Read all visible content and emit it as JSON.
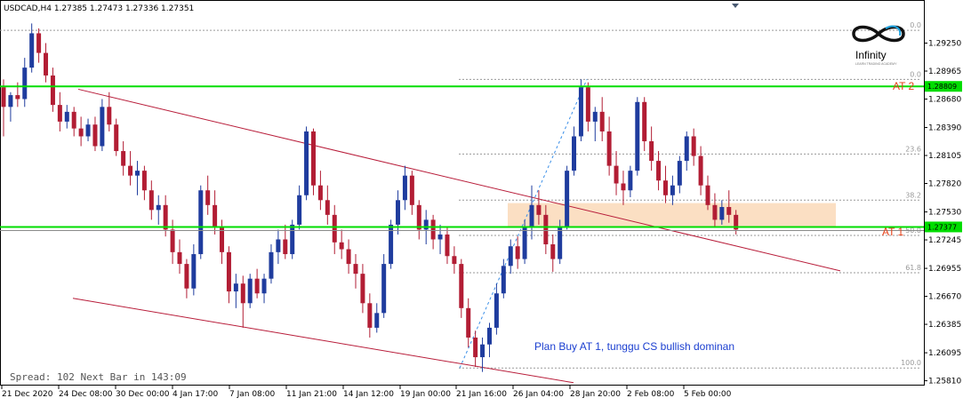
{
  "header": {
    "text": "USDCAD,H4  1.27385 1.27473 1.27336 1.27351"
  },
  "logo": {
    "name": "Infinity",
    "tagline": "LEARN TRADING ACADEMY"
  },
  "status": {
    "spread": "Spread: 102 Next Bar in 143:09"
  },
  "note": {
    "text": "Plan Buy AT 1, tunggu CS bullish dominan"
  },
  "levels": {
    "at2": {
      "label": "AT 2",
      "price": 1.28809,
      "badge": "1.28809"
    },
    "at1": {
      "label": "AT 1",
      "price": 1.27377,
      "badge": "1.27377"
    }
  },
  "colors": {
    "bull": "#1f3c9e",
    "bear": "#b21d34",
    "level": "#00dd00",
    "channel": "#b81d3a",
    "zone": "#fbdfc3",
    "fib": "#9a9a9a",
    "fib_trend": "#3b8fe8"
  },
  "chart_data": {
    "type": "candlestick",
    "symbol": "USDCAD",
    "timeframe": "H4",
    "ohlc_current": {
      "open": 1.27385,
      "high": 1.27473,
      "low": 1.27336,
      "close": 1.27351
    },
    "ylim": [
      1.2577,
      1.2968
    ],
    "y_ticks": [
      "1.29250",
      "1.28965",
      "1.28680",
      "1.28390",
      "1.28105",
      "1.27820",
      "1.27530",
      "1.27245",
      "1.26955",
      "1.26670",
      "1.26385",
      "1.26095",
      "1.25810"
    ],
    "x_ticks": [
      "21 Dec 2020",
      "24 Dec 08:00",
      "30 Dec 00:00",
      "4 Jan 17:00",
      "7 Jan 08:00",
      "11 Jan 21:00",
      "14 Jan 12:00",
      "19 Jan 00:00",
      "21 Jan 16:00",
      "26 Jan 04:00",
      "28 Jan 20:00",
      "2 Feb 08:00",
      "5 Feb 00:00"
    ],
    "fibonacci": {
      "levels": [
        {
          "label": "0.0",
          "price": 1.2938
        },
        {
          "label": "0.0",
          "price": 1.2888
        },
        {
          "label": "23.6",
          "price": 1.2812
        },
        {
          "label": "38.2",
          "price": 1.2765
        },
        {
          "label": "50.0",
          "price": 1.2729
        },
        {
          "label": "61.8",
          "price": 1.2691
        },
        {
          "label": "100.0",
          "price": 1.2594
        }
      ]
    },
    "channel_upper": [
      {
        "x": "24 Dec 08:00",
        "y": 1.2878
      },
      {
        "x": "26 Jan 04:00",
        "y": 1.2766
      },
      {
        "x": "8 Feb",
        "y": 1.2693
      }
    ],
    "channel_lower": [
      {
        "x": "23 Dec",
        "y": 1.2665
      },
      {
        "x": "21 Jan 16:00",
        "y": 1.259
      },
      {
        "x": "28 Jan 20:00",
        "y": 1.2579
      }
    ],
    "zone": {
      "price_high": 1.2762,
      "price_low": 1.2738,
      "from": "21 Jan 16:00",
      "to": "8 Feb"
    },
    "candles": [
      {
        "o": 1.288,
        "h": 1.2888,
        "l": 1.283,
        "c": 1.286
      },
      {
        "o": 1.286,
        "h": 1.2875,
        "l": 1.2845,
        "c": 1.2872
      },
      {
        "o": 1.2872,
        "h": 1.2885,
        "l": 1.286,
        "c": 1.2868
      },
      {
        "o": 1.2868,
        "h": 1.291,
        "l": 1.286,
        "c": 1.29
      },
      {
        "o": 1.29,
        "h": 1.2945,
        "l": 1.2895,
        "c": 1.2935
      },
      {
        "o": 1.2935,
        "h": 1.294,
        "l": 1.2905,
        "c": 1.2915
      },
      {
        "o": 1.2915,
        "h": 1.2925,
        "l": 1.2885,
        "c": 1.2892
      },
      {
        "o": 1.2892,
        "h": 1.29,
        "l": 1.2855,
        "c": 1.2862
      },
      {
        "o": 1.2862,
        "h": 1.2875,
        "l": 1.2835,
        "c": 1.2845
      },
      {
        "o": 1.2845,
        "h": 1.2862,
        "l": 1.2838,
        "c": 1.2855
      },
      {
        "o": 1.2855,
        "h": 1.286,
        "l": 1.283,
        "c": 1.2838
      },
      {
        "o": 1.2838,
        "h": 1.285,
        "l": 1.282,
        "c": 1.283
      },
      {
        "o": 1.283,
        "h": 1.2848,
        "l": 1.2825,
        "c": 1.2842
      },
      {
        "o": 1.2842,
        "h": 1.285,
        "l": 1.2815,
        "c": 1.282
      },
      {
        "o": 1.282,
        "h": 1.2868,
        "l": 1.2815,
        "c": 1.286
      },
      {
        "o": 1.286,
        "h": 1.2875,
        "l": 1.2835,
        "c": 1.2842
      },
      {
        "o": 1.2842,
        "h": 1.2848,
        "l": 1.281,
        "c": 1.2815
      },
      {
        "o": 1.2815,
        "h": 1.2825,
        "l": 1.279,
        "c": 1.28
      },
      {
        "o": 1.28,
        "h": 1.2815,
        "l": 1.278,
        "c": 1.279
      },
      {
        "o": 1.279,
        "h": 1.2805,
        "l": 1.277,
        "c": 1.2795
      },
      {
        "o": 1.2795,
        "h": 1.28,
        "l": 1.2765,
        "c": 1.2775
      },
      {
        "o": 1.2775,
        "h": 1.2785,
        "l": 1.2745,
        "c": 1.2755
      },
      {
        "o": 1.2755,
        "h": 1.277,
        "l": 1.274,
        "c": 1.276
      },
      {
        "o": 1.276,
        "h": 1.277,
        "l": 1.2728,
        "c": 1.2735
      },
      {
        "o": 1.2735,
        "h": 1.2745,
        "l": 1.27,
        "c": 1.2712
      },
      {
        "o": 1.2712,
        "h": 1.2725,
        "l": 1.269,
        "c": 1.27
      },
      {
        "o": 1.27,
        "h": 1.2705,
        "l": 1.2665,
        "c": 1.2675
      },
      {
        "o": 1.2675,
        "h": 1.272,
        "l": 1.2668,
        "c": 1.271
      },
      {
        "o": 1.271,
        "h": 1.278,
        "l": 1.2705,
        "c": 1.2775
      },
      {
        "o": 1.2775,
        "h": 1.279,
        "l": 1.275,
        "c": 1.276
      },
      {
        "o": 1.276,
        "h": 1.2775,
        "l": 1.273,
        "c": 1.2738
      },
      {
        "o": 1.2738,
        "h": 1.2745,
        "l": 1.27,
        "c": 1.2712
      },
      {
        "o": 1.2712,
        "h": 1.2718,
        "l": 1.266,
        "c": 1.2672
      },
      {
        "o": 1.2672,
        "h": 1.269,
        "l": 1.2655,
        "c": 1.268
      },
      {
        "o": 1.268,
        "h": 1.2688,
        "l": 1.2635,
        "c": 1.266
      },
      {
        "o": 1.266,
        "h": 1.269,
        "l": 1.2655,
        "c": 1.2685
      },
      {
        "o": 1.2685,
        "h": 1.2695,
        "l": 1.2665,
        "c": 1.267
      },
      {
        "o": 1.267,
        "h": 1.269,
        "l": 1.266,
        "c": 1.2685
      },
      {
        "o": 1.2685,
        "h": 1.272,
        "l": 1.268,
        "c": 1.2712
      },
      {
        "o": 1.2712,
        "h": 1.2735,
        "l": 1.27,
        "c": 1.2725
      },
      {
        "o": 1.2725,
        "h": 1.274,
        "l": 1.2705,
        "c": 1.271
      },
      {
        "o": 1.271,
        "h": 1.2745,
        "l": 1.2705,
        "c": 1.274
      },
      {
        "o": 1.274,
        "h": 1.278,
        "l": 1.2735,
        "c": 1.277
      },
      {
        "o": 1.277,
        "h": 1.284,
        "l": 1.2765,
        "c": 1.2835
      },
      {
        "o": 1.2835,
        "h": 1.2838,
        "l": 1.277,
        "c": 1.278
      },
      {
        "o": 1.278,
        "h": 1.2795,
        "l": 1.2755,
        "c": 1.2765
      },
      {
        "o": 1.2765,
        "h": 1.278,
        "l": 1.274,
        "c": 1.275
      },
      {
        "o": 1.275,
        "h": 1.276,
        "l": 1.271,
        "c": 1.2722
      },
      {
        "o": 1.2722,
        "h": 1.2735,
        "l": 1.2705,
        "c": 1.2715
      },
      {
        "o": 1.2715,
        "h": 1.2725,
        "l": 1.269,
        "c": 1.27
      },
      {
        "o": 1.27,
        "h": 1.271,
        "l": 1.2675,
        "c": 1.269
      },
      {
        "o": 1.269,
        "h": 1.27,
        "l": 1.265,
        "c": 1.266
      },
      {
        "o": 1.266,
        "h": 1.267,
        "l": 1.2625,
        "c": 1.2635
      },
      {
        "o": 1.2635,
        "h": 1.266,
        "l": 1.263,
        "c": 1.265
      },
      {
        "o": 1.265,
        "h": 1.271,
        "l": 1.2645,
        "c": 1.27
      },
      {
        "o": 1.27,
        "h": 1.2745,
        "l": 1.2695,
        "c": 1.274
      },
      {
        "o": 1.274,
        "h": 1.2775,
        "l": 1.273,
        "c": 1.2765
      },
      {
        "o": 1.2765,
        "h": 1.28,
        "l": 1.2755,
        "c": 1.279
      },
      {
        "o": 1.279,
        "h": 1.2795,
        "l": 1.275,
        "c": 1.276
      },
      {
        "o": 1.276,
        "h": 1.2765,
        "l": 1.2725,
        "c": 1.2735
      },
      {
        "o": 1.2735,
        "h": 1.2755,
        "l": 1.272,
        "c": 1.2745
      },
      {
        "o": 1.2745,
        "h": 1.275,
        "l": 1.2715,
        "c": 1.2725
      },
      {
        "o": 1.2725,
        "h": 1.274,
        "l": 1.271,
        "c": 1.273
      },
      {
        "o": 1.273,
        "h": 1.2738,
        "l": 1.27,
        "c": 1.2708
      },
      {
        "o": 1.2708,
        "h": 1.2718,
        "l": 1.269,
        "c": 1.27
      },
      {
        "o": 1.27,
        "h": 1.2705,
        "l": 1.2645,
        "c": 1.2655
      },
      {
        "o": 1.2655,
        "h": 1.2665,
        "l": 1.2615,
        "c": 1.2625
      },
      {
        "o": 1.2625,
        "h": 1.2632,
        "l": 1.2595,
        "c": 1.2605
      },
      {
        "o": 1.2605,
        "h": 1.2625,
        "l": 1.259,
        "c": 1.2618
      },
      {
        "o": 1.2618,
        "h": 1.264,
        "l": 1.2605,
        "c": 1.2635
      },
      {
        "o": 1.2635,
        "h": 1.268,
        "l": 1.2628,
        "c": 1.267
      },
      {
        "o": 1.267,
        "h": 1.2705,
        "l": 1.2665,
        "c": 1.2698
      },
      {
        "o": 1.2698,
        "h": 1.2725,
        "l": 1.269,
        "c": 1.2718
      },
      {
        "o": 1.2718,
        "h": 1.2728,
        "l": 1.2695,
        "c": 1.2705
      },
      {
        "o": 1.2705,
        "h": 1.2745,
        "l": 1.27,
        "c": 1.2738
      },
      {
        "o": 1.2738,
        "h": 1.278,
        "l": 1.2725,
        "c": 1.276
      },
      {
        "o": 1.276,
        "h": 1.2775,
        "l": 1.274,
        "c": 1.275
      },
      {
        "o": 1.275,
        "h": 1.276,
        "l": 1.271,
        "c": 1.272
      },
      {
        "o": 1.272,
        "h": 1.273,
        "l": 1.2692,
        "c": 1.2705
      },
      {
        "o": 1.2705,
        "h": 1.2745,
        "l": 1.27,
        "c": 1.2738
      },
      {
        "o": 1.2738,
        "h": 1.28,
        "l": 1.2735,
        "c": 1.2795
      },
      {
        "o": 1.2795,
        "h": 1.284,
        "l": 1.279,
        "c": 1.283
      },
      {
        "o": 1.283,
        "h": 1.2888,
        "l": 1.2825,
        "c": 1.288
      },
      {
        "o": 1.288,
        "h": 1.2885,
        "l": 1.2835,
        "c": 1.2845
      },
      {
        "o": 1.2845,
        "h": 1.286,
        "l": 1.2825,
        "c": 1.2855
      },
      {
        "o": 1.2855,
        "h": 1.287,
        "l": 1.2825,
        "c": 1.2835
      },
      {
        "o": 1.2835,
        "h": 1.285,
        "l": 1.279,
        "c": 1.28
      },
      {
        "o": 1.28,
        "h": 1.2815,
        "l": 1.277,
        "c": 1.2782
      },
      {
        "o": 1.2782,
        "h": 1.2795,
        "l": 1.276,
        "c": 1.2775
      },
      {
        "o": 1.2775,
        "h": 1.28,
        "l": 1.2768,
        "c": 1.2795
      },
      {
        "o": 1.2795,
        "h": 1.287,
        "l": 1.279,
        "c": 1.2865
      },
      {
        "o": 1.2865,
        "h": 1.287,
        "l": 1.2815,
        "c": 1.2825
      },
      {
        "o": 1.2825,
        "h": 1.284,
        "l": 1.2795,
        "c": 1.2805
      },
      {
        "o": 1.2805,
        "h": 1.2815,
        "l": 1.2775,
        "c": 1.2785
      },
      {
        "o": 1.2785,
        "h": 1.28,
        "l": 1.2762,
        "c": 1.277
      },
      {
        "o": 1.277,
        "h": 1.279,
        "l": 1.276,
        "c": 1.278
      },
      {
        "o": 1.278,
        "h": 1.281,
        "l": 1.2772,
        "c": 1.2805
      },
      {
        "o": 1.2805,
        "h": 1.2835,
        "l": 1.2795,
        "c": 1.283
      },
      {
        "o": 1.283,
        "h": 1.2838,
        "l": 1.28,
        "c": 1.281
      },
      {
        "o": 1.281,
        "h": 1.282,
        "l": 1.277,
        "c": 1.278
      },
      {
        "o": 1.278,
        "h": 1.279,
        "l": 1.2755,
        "c": 1.276
      },
      {
        "o": 1.276,
        "h": 1.2772,
        "l": 1.2738,
        "c": 1.2745
      },
      {
        "o": 1.2745,
        "h": 1.2765,
        "l": 1.274,
        "c": 1.2758
      },
      {
        "o": 1.2758,
        "h": 1.2775,
        "l": 1.2742,
        "c": 1.275
      },
      {
        "o": 1.275,
        "h": 1.2755,
        "l": 1.273,
        "c": 1.2735
      }
    ]
  }
}
